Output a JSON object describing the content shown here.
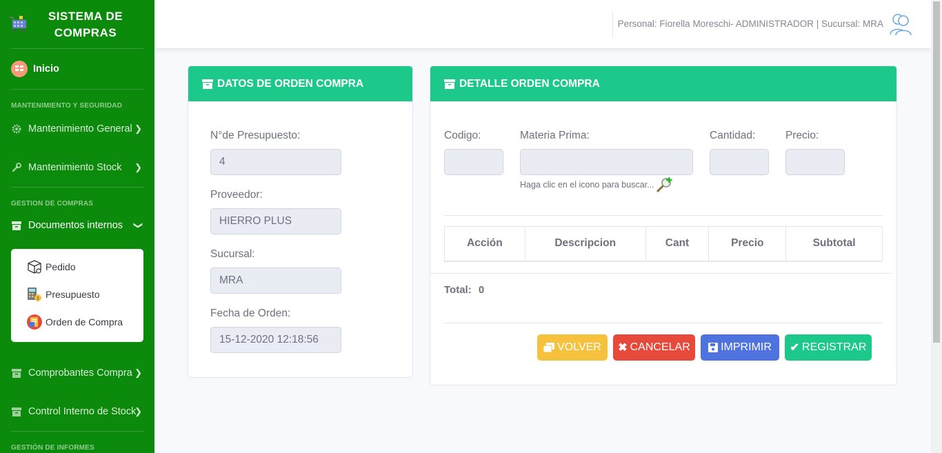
{
  "brand": {
    "title_line1": "SISTEMA DE",
    "title_line2": "COMPRAS"
  },
  "sidebar": {
    "home": "Inicio",
    "section1": "MANTENIMIENTO Y SEGURIDAD",
    "mant_general": "Mantenimiento General",
    "mant_stock": "Mantenimiento Stock",
    "section2": "GESTION DE COMPRAS",
    "docs_internos": "Documentos internos",
    "submenu": [
      "Pedido",
      "Presupuesto",
      "Orden de Compra"
    ],
    "comprobantes": "Comprobantes Compra",
    "control_stock": "Control Interno de Stock",
    "section3": "GESTIÓN DE INFORMES"
  },
  "topbar": {
    "user_text": "Personal: Fiorella Moreschi- ADMINISTRADOR | Sucursal: MRA"
  },
  "datos": {
    "header": "DATOS DE ORDEN COMPRA",
    "presupuesto_label": "N°de Presupuesto:",
    "presupuesto_value": "4",
    "proveedor_label": "Proveedor:",
    "proveedor_value": "HIERRO PLUS",
    "sucursal_label": "Sucursal:",
    "sucursal_value": "MRA",
    "fecha_label": "Fecha de Orden:",
    "fecha_value": "15-12-2020 12:18:56"
  },
  "detalle": {
    "header": "DETALLE ORDEN COMPRA",
    "codigo_label": "Codigo:",
    "materia_label": "Materia Prima:",
    "cantidad_label": "Cantidad:",
    "precio_label": "Precio:",
    "hint": "Haga clic en el icono para buscar...",
    "columns": [
      "Acción",
      "Descripcion",
      "Cant",
      "Precio",
      "Subtotal"
    ],
    "total_label": "Total:",
    "total_value": "0"
  },
  "buttons": {
    "volver": "VOLVER",
    "cancelar": "CANCELAR",
    "imprimir": "IMPRIMIR",
    "registrar": "REGISTRAR"
  },
  "colors": {
    "sidebar": "#0b8a0b",
    "header": "#1cc88a",
    "warning": "#f6c23e",
    "danger": "#e74a3b",
    "primary": "#4e73df",
    "success": "#1cc88a"
  }
}
